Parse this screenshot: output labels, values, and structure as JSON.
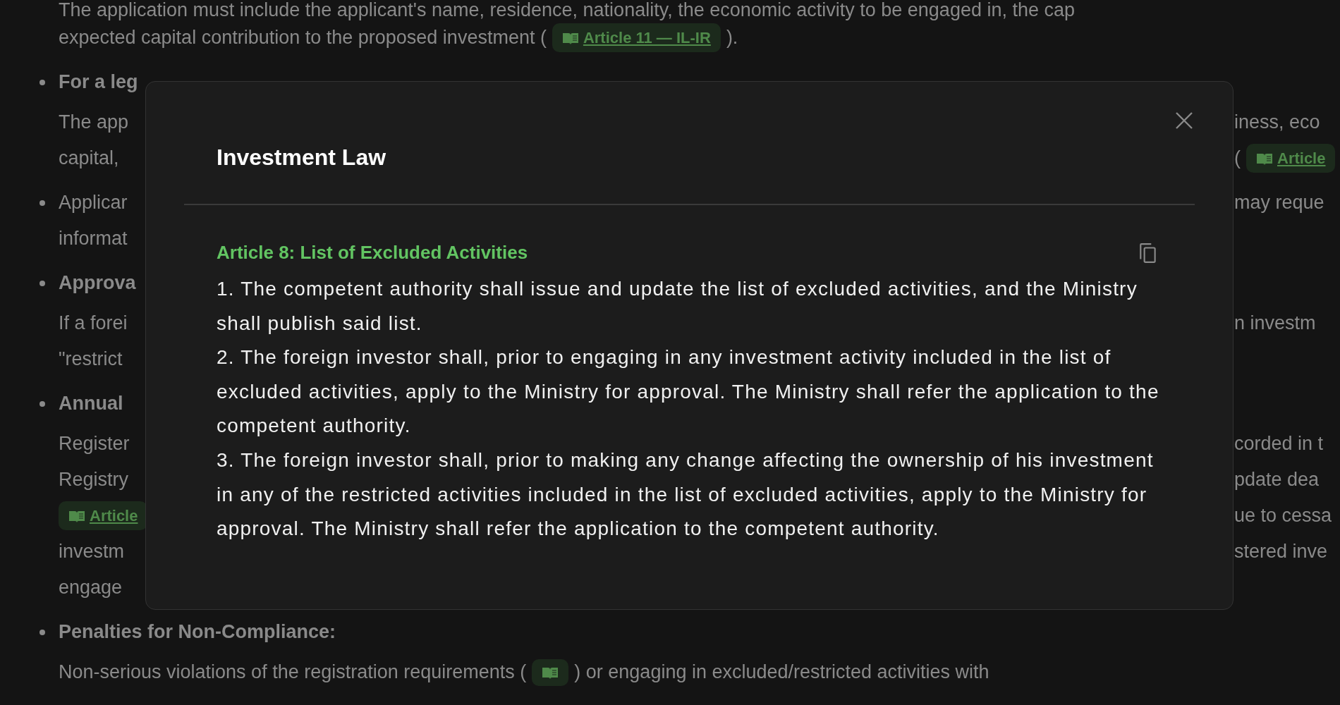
{
  "document": {
    "lines": [
      {
        "kind": "text",
        "left": [
          {
            "kind": "text",
            "text": "The application must include the applicant's name, residence, nationality, the economic activity to be engaged in, the cap"
          }
        ]
      },
      {
        "kind": "text",
        "left": [
          {
            "kind": "text",
            "text": "expected capital contribution to the proposed investment ("
          },
          {
            "kind": "tag",
            "text": "Article 11 — IL-IR"
          },
          {
            "kind": "text",
            "text": ")."
          }
        ]
      },
      {
        "kind": "heading",
        "left": [
          {
            "kind": "text",
            "text": "For a leg"
          }
        ]
      },
      {
        "kind": "text",
        "left": [
          {
            "kind": "text",
            "text": "The app"
          }
        ],
        "right": [
          {
            "kind": "text",
            "text": "iness, eco"
          }
        ]
      },
      {
        "kind": "text",
        "left": [
          {
            "kind": "text",
            "text": "capital,"
          }
        ],
        "right": [
          {
            "kind": "text",
            "text": "("
          },
          {
            "kind": "tag",
            "text": "Article"
          }
        ]
      },
      {
        "kind": "bullet",
        "left": [
          {
            "kind": "text",
            "text": "Applicar"
          }
        ],
        "right": [
          {
            "kind": "text",
            "text": "may reque"
          }
        ]
      },
      {
        "kind": "text",
        "left": [
          {
            "kind": "text",
            "text": "informat"
          }
        ]
      },
      {
        "kind": "heading",
        "left": [
          {
            "kind": "text",
            "text": "Approva"
          }
        ]
      },
      {
        "kind": "text",
        "left": [
          {
            "kind": "text",
            "text": "If a forei"
          }
        ],
        "right": [
          {
            "kind": "text",
            "text": "n investm"
          }
        ]
      },
      {
        "kind": "text",
        "left": [
          {
            "kind": "text",
            "text": "\"restrict"
          }
        ]
      },
      {
        "kind": "heading",
        "left": [
          {
            "kind": "text",
            "text": "Annual"
          }
        ]
      },
      {
        "kind": "text",
        "left": [
          {
            "kind": "text",
            "text": "Register"
          }
        ],
        "right": [
          {
            "kind": "text",
            "text": "corded in t"
          }
        ]
      },
      {
        "kind": "text",
        "left": [
          {
            "kind": "text",
            "text": "Registry"
          }
        ],
        "right": [
          {
            "kind": "text",
            "text": "pdate dea"
          }
        ]
      },
      {
        "kind": "text",
        "left": [
          {
            "kind": "tag",
            "text": "Article"
          }
        ],
        "right": [
          {
            "kind": "text",
            "text": "ue to cessa"
          }
        ]
      },
      {
        "kind": "text",
        "left": [
          {
            "kind": "text",
            "text": "investm"
          }
        ],
        "right": [
          {
            "kind": "text",
            "text": "stered inve"
          }
        ]
      },
      {
        "kind": "text",
        "left": [
          {
            "kind": "text",
            "text": "engage"
          }
        ]
      },
      {
        "kind": "heading",
        "left": [
          {
            "kind": "text",
            "text": "Penalties for Non-Compliance:"
          }
        ]
      },
      {
        "kind": "text",
        "left": [
          {
            "kind": "text",
            "text": "Non-serious violations of the registration requirements ("
          },
          {
            "kind": "tag"
          },
          {
            "kind": "text",
            "text": ") or engaging in excluded/restricted activities with"
          }
        ]
      }
    ]
  },
  "modal": {
    "title": "Investment Law",
    "article_title": "Article 8: List of Excluded Activities",
    "paragraphs": [
      "1. The competent authority shall issue and update the list of excluded activities, and the Ministry shall publish said list.",
      "2. The foreign investor shall, prior to engaging in any investment activity included in the list of excluded activities, apply to the Ministry for approval. The Ministry shall refer the application to the competent authority.",
      "3. The foreign investor shall, prior to making any change affecting the ownership of his investment in any of the restricted activities included in the list of excluded activities, apply to the Ministry for approval. The Ministry shall refer the application to the competent authority."
    ]
  }
}
